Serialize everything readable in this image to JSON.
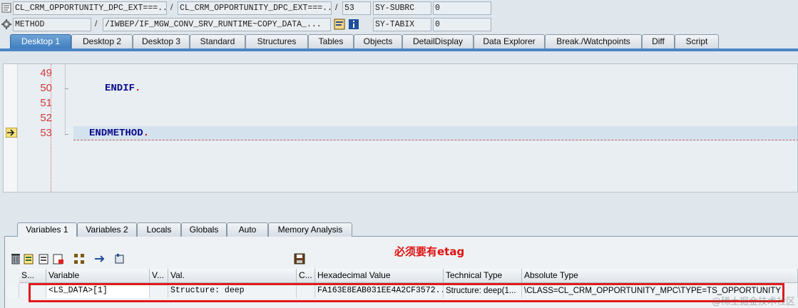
{
  "header": {
    "row1": {
      "program": "CL_CRM_OPPORTUNITY_DPC_EXT===...",
      "include": "CL_CRM_OPPORTUNITY_DPC_EXT===...",
      "sep1": "/",
      "sep2": "/",
      "line": "53",
      "sysvar_name": "SY-SUBRC",
      "sysvar_value": "0"
    },
    "row2": {
      "event_type": "METHOD",
      "sep": "/",
      "event": "/IWBEP/IF_MGW_CONV_SRV_RUNTIME~COPY_DATA_...",
      "sysvar_name": "SY-TABIX",
      "sysvar_value": "0"
    }
  },
  "tabs": [
    "Desktop 1",
    "Desktop 2",
    "Desktop 3",
    "Standard",
    "Structures",
    "Tables",
    "Objects",
    "DetailDisplay",
    "Data Explorer",
    "Break./Watchpoints",
    "Diff",
    "Script"
  ],
  "editor": {
    "line_numbers": [
      "49",
      "50",
      "51",
      "52",
      "53"
    ],
    "lines": {
      "l50": "ENDIF",
      "l53": "ENDMETHOD"
    },
    "period": "."
  },
  "var_tabs": [
    "Variables 1",
    "Variables 2",
    "Locals",
    "Globals",
    "Auto",
    "Memory Analysis"
  ],
  "annotation": "必须要有etag",
  "grid": {
    "headers": [
      "S...",
      "Variable",
      "V...",
      "Val.",
      "C...",
      "Hexadecimal Value",
      "Technical Type",
      "Absolute Type"
    ],
    "row": {
      "variable": "<LS_DATA>[1]",
      "value": "Structure: deep",
      "hex": "FA163E8EAB031EE4A2CF3572...",
      "technical_type": "Structure: deep(1...",
      "absolute_type": "\\CLASS=CL_CRM_OPPORTUNITY_MPC\\TYPE=TS_OPPORTUNITY"
    }
  },
  "watermark": "@稀土掘金技术社区",
  "colors": {
    "active_tab": "#4a86c4",
    "line_number": "#d23b3b",
    "keyword": "#0a0a8a",
    "highlight_box": "#e01a1a"
  }
}
